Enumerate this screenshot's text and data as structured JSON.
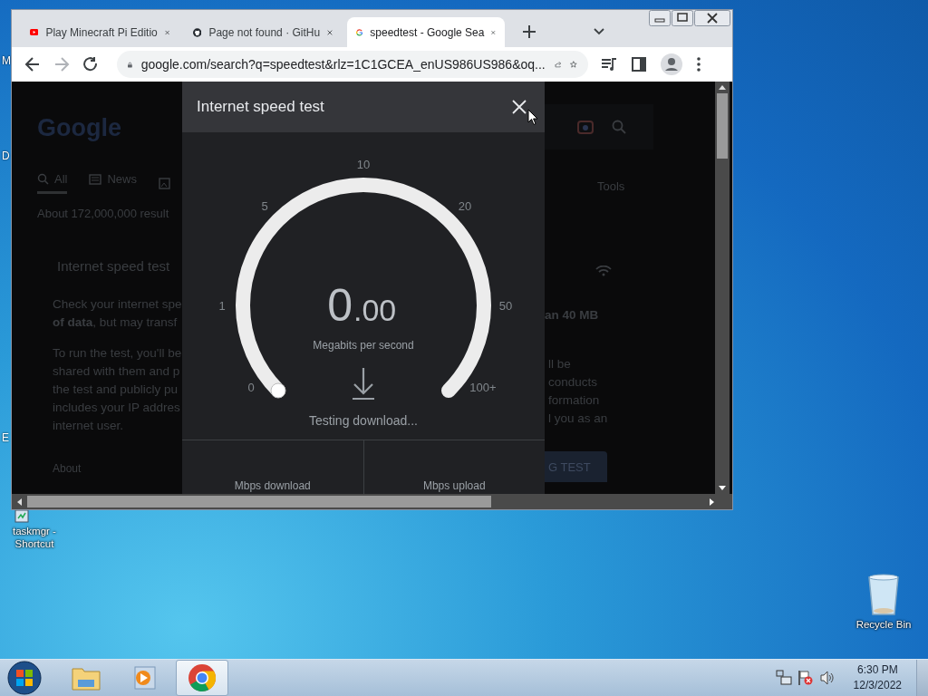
{
  "desktop": {
    "hidden_labels": [
      "M",
      "D",
      "E"
    ],
    "shortcut": {
      "label": "taskmgr - Shortcut"
    },
    "recycle_bin": {
      "label": "Recycle Bin"
    }
  },
  "browser": {
    "tabs": [
      {
        "kind": "youtube",
        "title": "Play Minecraft Pi Editio",
        "selected": false
      },
      {
        "kind": "github",
        "title": "Page not found · GitHu",
        "selected": false
      },
      {
        "kind": "google",
        "title": "speedtest - Google Sea",
        "selected": true
      }
    ],
    "nav_buttons": [
      {
        "kind": "back",
        "disabled": false
      },
      {
        "kind": "forward",
        "disabled": true
      },
      {
        "kind": "reload",
        "disabled": false
      }
    ],
    "address": "google.com/search?q=speedtest&rlz=1C1GCEA_enUS986US986&oq..."
  },
  "background_page": {
    "logo": "Google",
    "nav": [
      {
        "kind": "search",
        "label": "All",
        "selected": true
      },
      {
        "kind": "news",
        "label": "News",
        "selected": false
      }
    ],
    "tools": "Tools",
    "result_count": "About 172,000,000 result",
    "card_title": "Internet speed test",
    "left_paragraphs": [
      [
        "Check your internet spe",
        "**of data**, but may transf"
      ],
      [
        "To run the test, you'll be",
        "shared with them and p",
        "the test and publicly pu",
        "includes your IP addres",
        "internet user."
      ]
    ],
    "right_paragraphs": [
      [
        {
          "text": "an 40 MB",
          "bold": true
        }
      ],
      [
        {
          "text": "ll be",
          "bold": false
        },
        {
          "text": "conducts",
          "bold": false
        },
        {
          "text": "formation",
          "bold": false
        },
        {
          "text": "l you as an",
          "bold": false
        }
      ]
    ],
    "about": "About",
    "button": "G TEST"
  },
  "dialog": {
    "title": "Internet speed test",
    "ticks": [
      "0",
      "1",
      "5",
      "10",
      "20",
      "50",
      "100+"
    ],
    "value": "0",
    "decimals": ".00",
    "unit": "Megabits per second",
    "status": "Testing download...",
    "results": [
      "Mbps download",
      "Mbps upload"
    ]
  },
  "taskbar": {
    "apps": [
      {
        "kind": "explorer",
        "active": false
      },
      {
        "kind": "media",
        "active": false
      },
      {
        "kind": "chrome",
        "active": true
      }
    ],
    "time": "6:30 PM",
    "date": "12/3/2022"
  }
}
